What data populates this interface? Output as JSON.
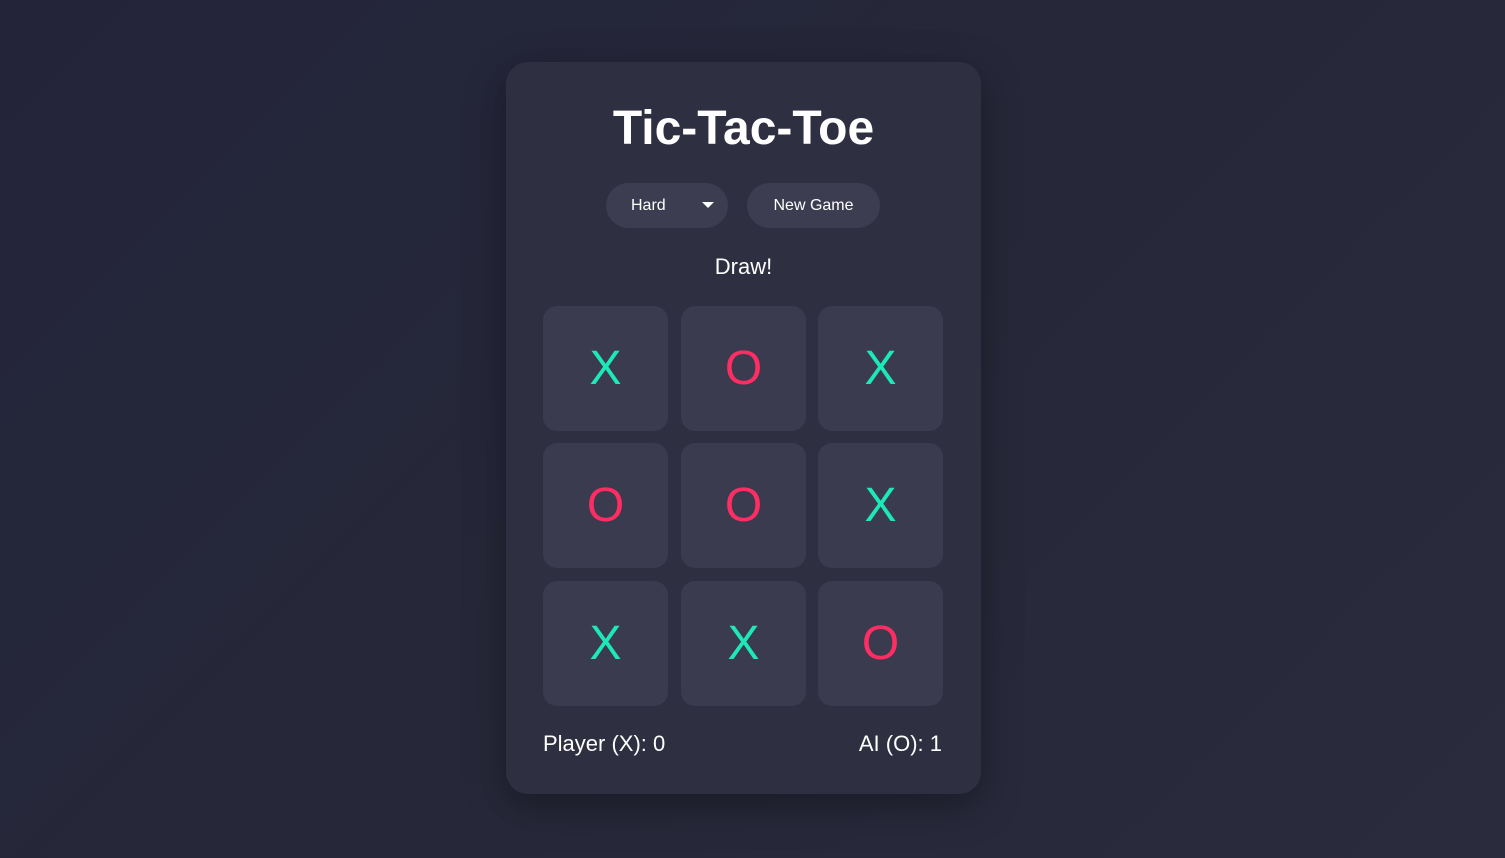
{
  "game": {
    "title": "Tic-Tac-Toe",
    "difficulty": {
      "selected": "Hard",
      "icon": "chevron-down-icon"
    },
    "new_game_label": "New Game",
    "status": "Draw!",
    "board": [
      "X",
      "O",
      "X",
      "O",
      "O",
      "X",
      "X",
      "X",
      "O"
    ],
    "score": {
      "player": "Player (X): 0",
      "ai": "AI (O): 1"
    },
    "colors": {
      "x": "#1de9b6",
      "o": "#ff2d63",
      "card": "#2e2f41",
      "cell": "#3a3b4e"
    }
  }
}
